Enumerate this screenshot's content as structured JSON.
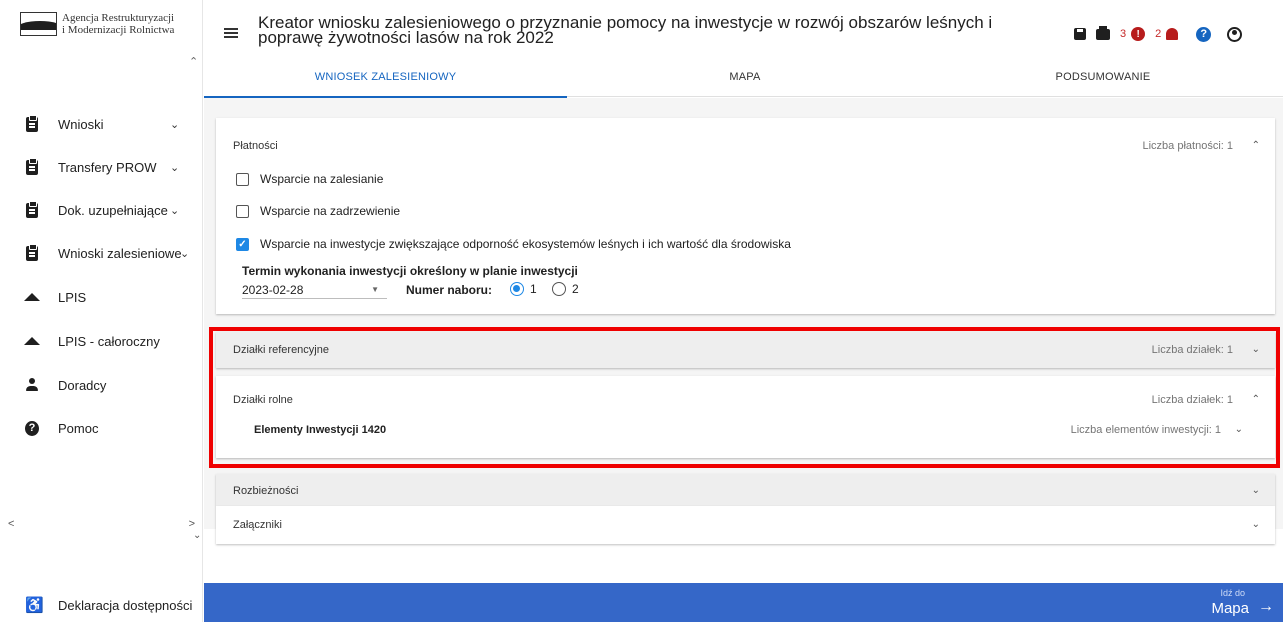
{
  "sidebar": {
    "logo_line1": "Agencja Restrukturyzacji",
    "logo_line2": "i Modernizacji Rolnictwa",
    "items": [
      {
        "label": "Wnioski",
        "icon": "clipboard-icon",
        "chevron": "⌄"
      },
      {
        "label": "Transfery PROW",
        "icon": "clipboard-icon",
        "chevron": "⌄"
      },
      {
        "label": "Dok. uzupełniające",
        "icon": "clipboard-icon",
        "chevron": "⌄"
      },
      {
        "label": "Wnioski zalesieniowe",
        "icon": "clipboard-icon",
        "chevron": "⌄"
      },
      {
        "label": "LPIS",
        "icon": "mountain-icon"
      },
      {
        "label": "LPIS - całoroczny",
        "icon": "mountain-icon"
      },
      {
        "label": "Doradcy",
        "icon": "person-icon"
      },
      {
        "label": "Pomoc",
        "icon": "help-icon"
      }
    ],
    "declaration": "Deklaracja dostępności"
  },
  "header": {
    "title": "Kreator wniosku zalesieniowego o przyznanie pomocy na inwestycje w rozwój obszarów leśnych i poprawę żywotności lasów na rok 2022",
    "errors_count": "3",
    "notifications_count": "2"
  },
  "tabs": [
    {
      "label": "WNIOSEK ZALESIENIOWY",
      "active": true
    },
    {
      "label": "MAPA",
      "active": false
    },
    {
      "label": "PODSUMOWANIE",
      "active": false
    }
  ],
  "platnosci": {
    "title": "Płatności",
    "count": "Liczba płatności: 1",
    "options": [
      {
        "label": "Wsparcie na zalesianie",
        "checked": false
      },
      {
        "label": "Wsparcie na zadrzewienie",
        "checked": false
      },
      {
        "label": "Wsparcie na inwestycje zwiększające odporność ekosystemów leśnych i ich wartość dla środowiska",
        "checked": true
      }
    ],
    "termin_label": "Termin wykonania inwestycji określony w planie inwestycji",
    "termin_value": "2023-02-28",
    "nabor_label": "Numer naboru:",
    "nabor_options": [
      "1",
      "2"
    ],
    "nabor_selected": "1"
  },
  "dzialki_ref": {
    "title": "Działki referencyjne",
    "count": "Liczba działek: 1"
  },
  "dzialki_rolne": {
    "title": "Działki rolne",
    "count": "Liczba działek: 1",
    "sub_title": "Elementy Inwestycji 1420",
    "sub_count": "Liczba elementów inwestycji: 1"
  },
  "rozbieznosci": {
    "title": "Rozbieżności"
  },
  "zalaczniki": {
    "title": "Załączniki"
  },
  "bottom": {
    "go_small": "Idź do",
    "go_big": "Mapa"
  },
  "colors": {
    "accent": "#1565c0",
    "bottom_bar": "#3567c8",
    "highlight": "#ef0000",
    "alert": "#b71c1c"
  }
}
